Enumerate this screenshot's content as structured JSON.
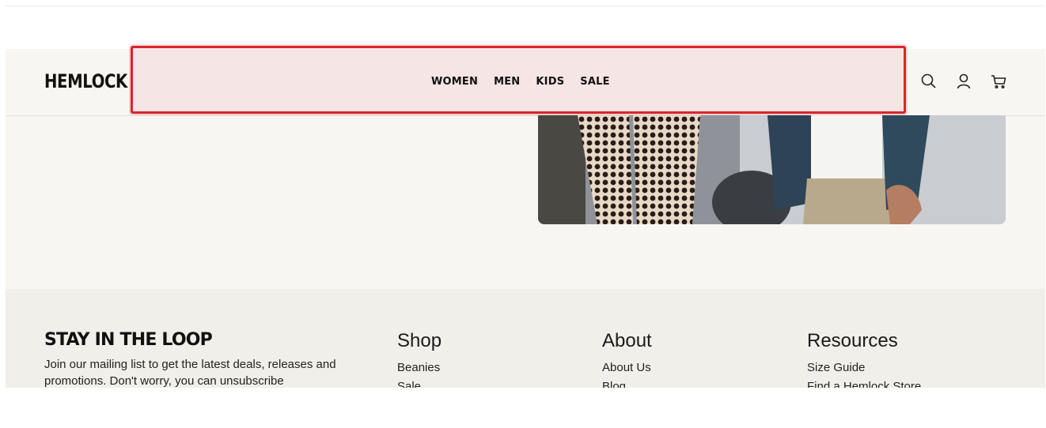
{
  "brand": {
    "name": "HEMLOCK"
  },
  "nav": {
    "items": [
      "WOMEN",
      "MEN",
      "KIDS",
      "SALE"
    ]
  },
  "header_icons": [
    "search-icon",
    "account-icon",
    "cart-icon"
  ],
  "footer": {
    "newsletter": {
      "title": "STAY IN THE LOOP",
      "text": "Join our mailing list to get the latest deals, releases and promotions. Don't worry, you can unsubscribe"
    },
    "columns": [
      {
        "title": "Shop",
        "links": [
          "Beanies",
          "Sale"
        ]
      },
      {
        "title": "About",
        "links": [
          "About Us",
          "Blog"
        ]
      },
      {
        "title": "Resources",
        "links": [
          "Size Guide",
          "Find a Hemlock Store"
        ]
      }
    ]
  },
  "colors": {
    "page_bg": "#f8f6f3",
    "footer_bg": "#f0efea",
    "overlay_border": "#d8262d"
  }
}
